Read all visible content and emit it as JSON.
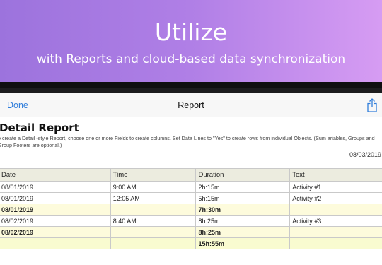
{
  "banner": {
    "title": "Utilize",
    "subtitle": "with Reports and cloud-based data synchronization"
  },
  "navbar": {
    "done_label": "Done",
    "title": "Report",
    "share_icon": "share-icon"
  },
  "report": {
    "title": "Detail Report",
    "description": "o create a Detail -style Report, choose one or more Fields to create columns. Set Data Lines to \"Yes\" to create rows from individual Objects. (Sum ariables, Groups and Group Footers are optional.)",
    "date": "08/03/2019"
  },
  "table": {
    "headers": [
      "Date",
      "Time",
      "Duration",
      "Text"
    ],
    "rows": [
      {
        "type": "data",
        "cells": [
          "08/01/2019",
          "9:00 AM",
          "2h:15m",
          "Activity #1"
        ]
      },
      {
        "type": "data",
        "cells": [
          "08/01/2019",
          "12:05 AM",
          "5h:15m",
          "Activity #2"
        ]
      },
      {
        "type": "footer",
        "cells": [
          "08/01/2019",
          "",
          "7h:30m",
          ""
        ]
      },
      {
        "type": "data",
        "cells": [
          "08/02/2019",
          "8:40 AM",
          "8h:25m",
          "Activity #3"
        ]
      },
      {
        "type": "footer",
        "cells": [
          "08/02/2019",
          "",
          "8h:25m",
          ""
        ]
      },
      {
        "type": "grand",
        "cells": [
          "",
          "",
          "15h:55m",
          ""
        ]
      }
    ]
  },
  "colors": {
    "banner_start": "#9c73dd",
    "banner_end": "#d69cf3",
    "accent": "#2f7ddb",
    "header_bg": "#ececdf",
    "footer_bg": "#fdfbdc"
  }
}
